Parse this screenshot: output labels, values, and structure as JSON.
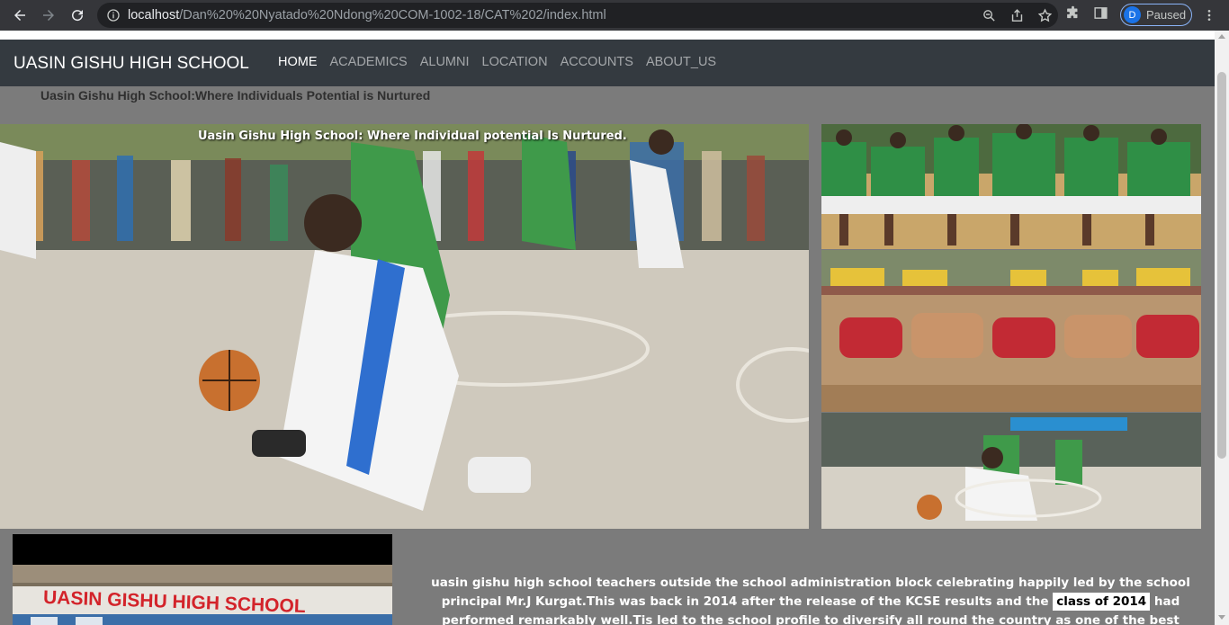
{
  "browser": {
    "url_host": "localhost",
    "url_path": "/Dan%20%20Nyatado%20Ndong%20COM-1002-18/CAT%202/index.html",
    "profile_initial": "D",
    "profile_status": "Paused",
    "icons": [
      "back-arrow-icon",
      "forward-arrow-icon",
      "reload-icon",
      "info-icon",
      "zoom-icon",
      "share-icon",
      "star-icon",
      "extensions-icon",
      "sidepanel-icon",
      "kebab-menu-icon"
    ]
  },
  "navbar": {
    "brand": "UASIN GISHU HIGH SCHOOL",
    "items": [
      {
        "label": "HOME",
        "active": true
      },
      {
        "label": "ACADEMICS",
        "active": false
      },
      {
        "label": "ALUMNI",
        "active": false
      },
      {
        "label": "LOCATION",
        "active": false
      },
      {
        "label": "ACCOUNTS",
        "active": false
      },
      {
        "label": "ABOUT_US",
        "active": false
      }
    ]
  },
  "tagline": "Uasin Gishu High School:Where Individuals Potential is Nurtured",
  "hero": {
    "caption": "Uasin Gishu High School: Where Individual potential Is Nurtured."
  },
  "school_sign": "UASIN GISHU HIGH SCHOOL",
  "description": {
    "part1": "uasin gishu high school teachers outside the school administration block celebrating happily led by the school principal Mr.J Kurgat.This was back in 2014 after the release of the KCSE results and the",
    "highlight": "class of 2014",
    "part2": "had performed remarkably well.Tis led to the school profile to diversify all round the country as one of the best performing day schools."
  },
  "colors": {
    "navbar_bg": "#343a40",
    "page_bg": "#7b7b7b",
    "chrome_bg": "#35363a"
  }
}
